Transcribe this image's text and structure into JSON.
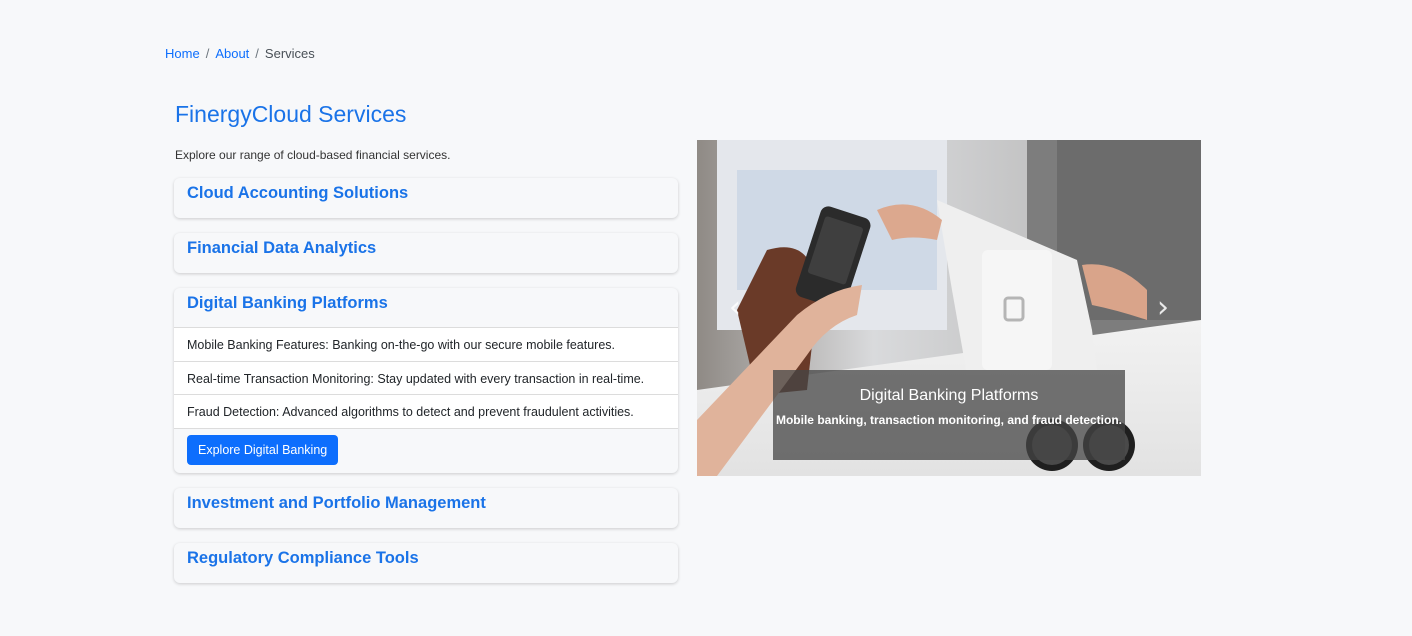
{
  "breadcrumb": {
    "items": [
      {
        "label": "Home",
        "link": true
      },
      {
        "label": "About",
        "link": true
      },
      {
        "label": "Services",
        "link": false
      }
    ],
    "separator": "/"
  },
  "page": {
    "title": "FinergyCloud Services",
    "intro": "Explore our range of cloud-based financial services."
  },
  "accordion": [
    {
      "title": "Cloud Accounting Solutions",
      "open": false
    },
    {
      "title": "Financial Data Analytics",
      "open": false
    },
    {
      "title": "Digital Banking Platforms",
      "open": true,
      "items": [
        "Mobile Banking Features: Banking on-the-go with our secure mobile features.",
        "Real-time Transaction Monitoring: Stay updated with every transaction in real-time.",
        "Fraud Detection: Advanced algorithms to detect and prevent fraudulent activities."
      ],
      "button": "Explore Digital Banking"
    },
    {
      "title": "Investment and Portfolio Management",
      "open": false
    },
    {
      "title": "Regulatory Compliance Tools",
      "open": false
    }
  ],
  "carousel": {
    "caption_title": "Digital Banking Platforms",
    "caption_text": "Mobile banking, transaction monitoring, and fraud detection.",
    "prev_icon": "chevron-left-icon",
    "next_icon": "chevron-right-icon"
  },
  "colors": {
    "accent": "#1a73e8",
    "button": "#0d6efd",
    "background": "#f7f8fa"
  }
}
